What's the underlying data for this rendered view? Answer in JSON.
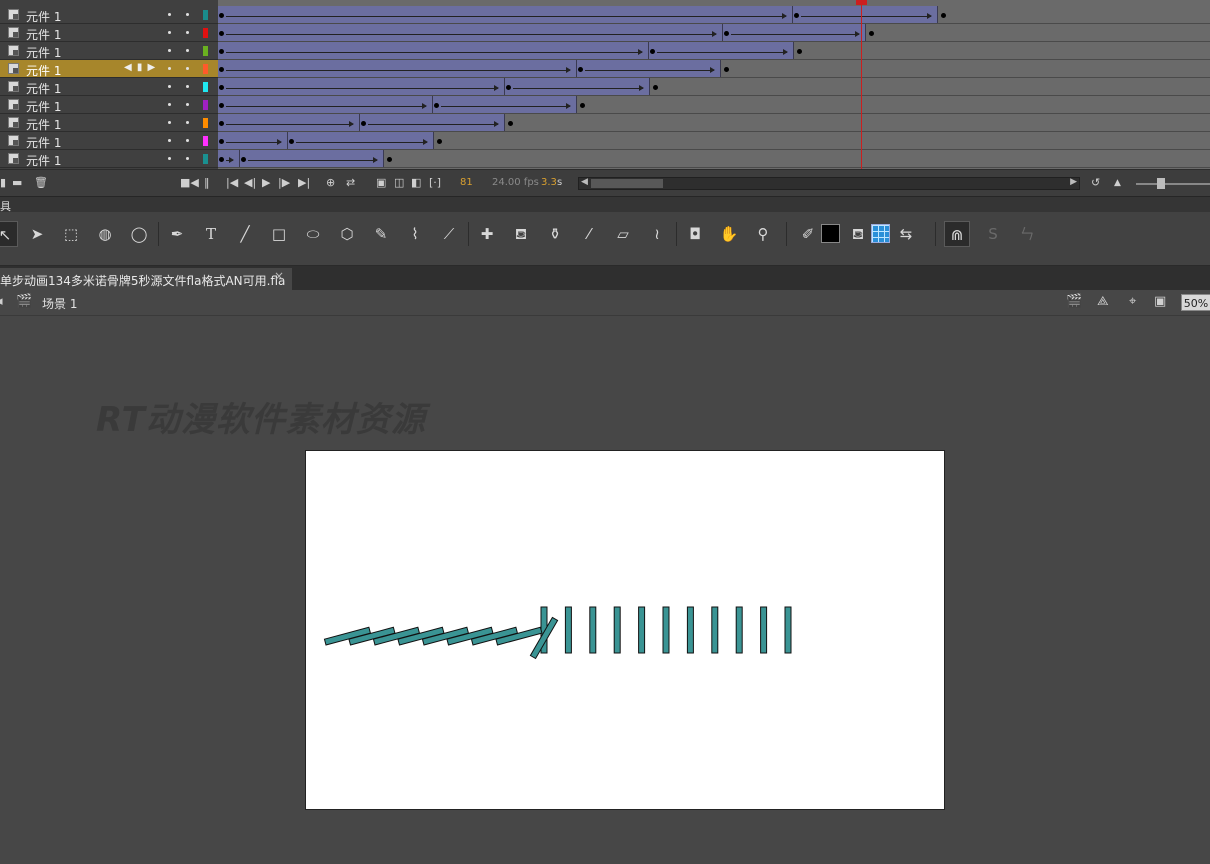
{
  "timeline": {
    "layers": [
      {
        "name": "元件 1",
        "color": "#1a8c8c",
        "selected": false,
        "tweens": [
          [
            0,
            575
          ],
          [
            575,
            720
          ]
        ],
        "end": 720
      },
      {
        "name": "元件 1",
        "color": "#e01010",
        "selected": false,
        "tweens": [
          [
            0,
            505
          ],
          [
            505,
            648
          ]
        ],
        "end": 648
      },
      {
        "name": "元件 1",
        "color": "#6ab020",
        "selected": false,
        "tweens": [
          [
            0,
            431
          ],
          [
            431,
            576
          ]
        ],
        "end": 576
      },
      {
        "name": "元件 1",
        "color": "#ff5a2a",
        "selected": true,
        "tweens": [
          [
            0,
            359
          ],
          [
            359,
            503
          ]
        ],
        "end": 503
      },
      {
        "name": "元件 1",
        "color": "#20e8f0",
        "selected": false,
        "tweens": [
          [
            0,
            287
          ],
          [
            287,
            432
          ]
        ],
        "end": 432
      },
      {
        "name": "元件 1",
        "color": "#a020c0",
        "selected": false,
        "tweens": [
          [
            0,
            215
          ],
          [
            215,
            359
          ]
        ],
        "end": 359
      },
      {
        "name": "元件 1",
        "color": "#ff8c00",
        "selected": false,
        "tweens": [
          [
            0,
            142
          ],
          [
            142,
            287
          ]
        ],
        "end": 287
      },
      {
        "name": "元件 1",
        "color": "#ff30ff",
        "selected": false,
        "tweens": [
          [
            0,
            70
          ],
          [
            70,
            216
          ]
        ],
        "end": 216
      },
      {
        "name": "元件 1",
        "color": "#1a9090",
        "selected": false,
        "tweens": [
          [
            0,
            22
          ],
          [
            22,
            166
          ]
        ],
        "end": 166
      }
    ],
    "selected_nav": "◀ ▮ ▶",
    "current_frame": "81",
    "fps": "24.00 fps",
    "time_value": "3.3",
    "time_unit": "s"
  },
  "tools_panel": {
    "title": "具"
  },
  "document": {
    "tab_title": "单步动画134多米诺骨牌5秒源文件fla格式AN可用.fla",
    "close_glyph": "×",
    "scene_label": "场景 1",
    "zoom": "50%"
  },
  "stage": {
    "watermark": "RT动漫软件素材资源",
    "domino_color": "#3a9494",
    "standing_dominoes": 11,
    "fallen_dominoes": 9
  }
}
